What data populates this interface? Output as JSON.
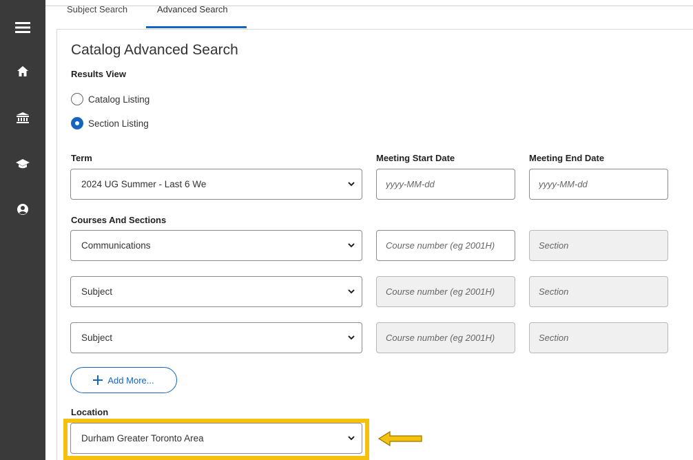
{
  "tabs": [
    {
      "label": "Subject Search"
    },
    {
      "label": "Advanced Search"
    }
  ],
  "sidebar": {
    "items": [
      {
        "icon": "menu-icon"
      },
      {
        "icon": "home-icon"
      },
      {
        "icon": "institution-icon"
      },
      {
        "icon": "graduation-cap-icon"
      },
      {
        "icon": "user-circle-icon"
      }
    ]
  },
  "page": {
    "title": "Catalog Advanced Search"
  },
  "results_view": {
    "label": "Results View",
    "options": [
      {
        "label": "Catalog Listing",
        "checked": false
      },
      {
        "label": "Section Listing",
        "checked": true
      }
    ]
  },
  "term": {
    "label": "Term",
    "value": "2024 UG Summer - Last 6 We"
  },
  "meeting_start": {
    "label": "Meeting Start Date",
    "placeholder": "yyyy-MM-dd"
  },
  "meeting_end": {
    "label": "Meeting End Date",
    "placeholder": "yyyy-MM-dd"
  },
  "courses": {
    "label": "Courses And Sections",
    "rows": [
      {
        "subject": "Communications",
        "course_placeholder": "Course number (eg 2001H)",
        "section_placeholder": "Section"
      },
      {
        "subject": "Subject",
        "course_placeholder": "Course number (eg 2001H)",
        "section_placeholder": "Section"
      },
      {
        "subject": "Subject",
        "course_placeholder": "Course number (eg 2001H)",
        "section_placeholder": "Section"
      }
    ]
  },
  "add_more": {
    "label": "Add More..."
  },
  "location": {
    "label": "Location",
    "value": "Durham Greater Toronto Area"
  },
  "colors": {
    "accent": "#1565c0",
    "highlight": "#f4c20d",
    "sidebar": "#3a3a3a"
  }
}
